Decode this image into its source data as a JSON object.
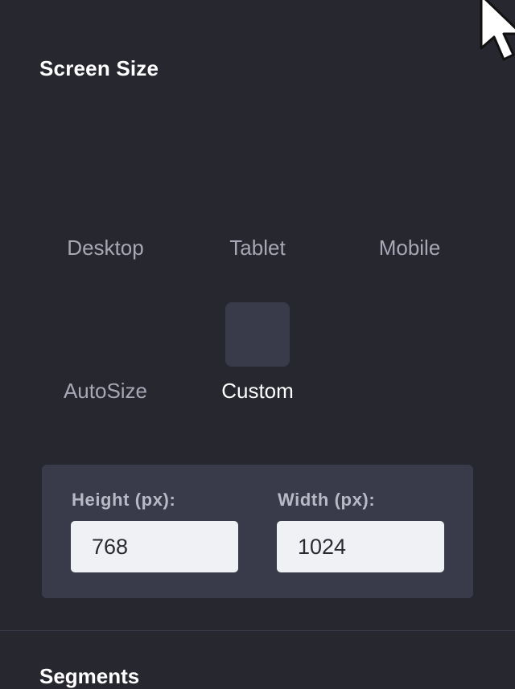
{
  "screen_size": {
    "title": "Screen Size",
    "options": [
      {
        "label": "Desktop",
        "selected": false
      },
      {
        "label": "Tablet",
        "selected": false
      },
      {
        "label": "Mobile",
        "selected": false
      },
      {
        "label": "AutoSize",
        "selected": false
      },
      {
        "label": "Custom",
        "selected": true
      }
    ],
    "custom": {
      "height_label": "Height (px):",
      "height_value": "768",
      "width_label": "Width (px):",
      "width_value": "1024"
    }
  },
  "segments": {
    "title": "Segments"
  },
  "cursor": {
    "icon": "mouse-pointer-icon"
  }
}
